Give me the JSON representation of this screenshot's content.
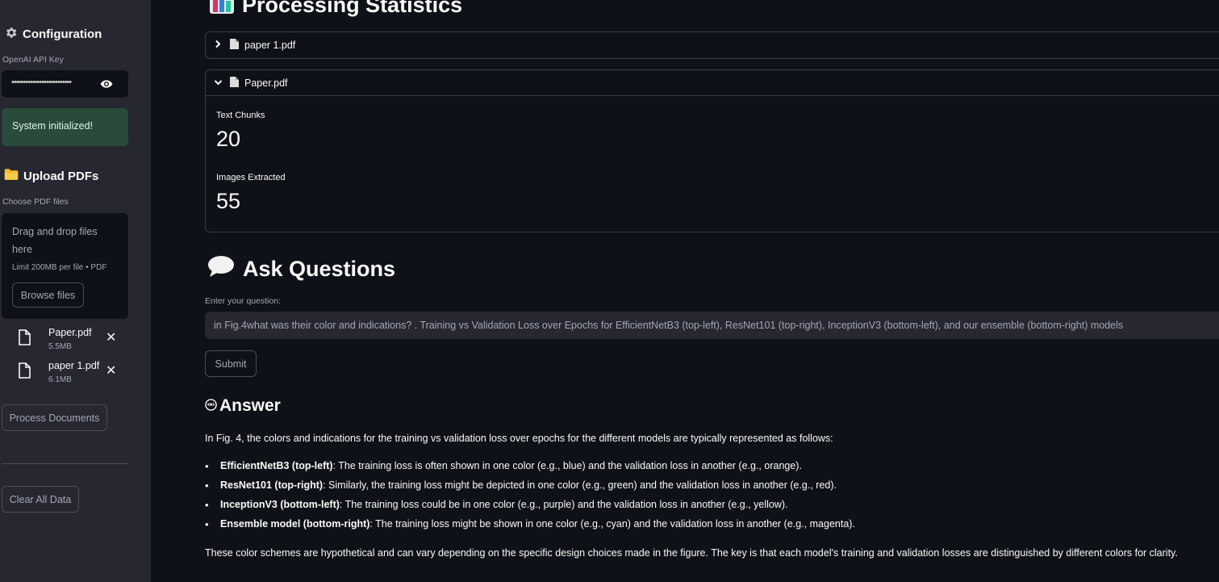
{
  "sidebar": {
    "config_title": "Configuration",
    "api_key_label": "OpenAI API Key",
    "api_key_masked": "••••••••••••••••••••••••••",
    "status_message": "System initialized!",
    "upload_title": "Upload PDFs",
    "choose_label": "Choose PDF files",
    "dropzone_line1": "Drag and drop files",
    "dropzone_line2": "here",
    "dropzone_limit": "Limit 200MB per file • PDF",
    "browse_label": "Browse files",
    "files": [
      {
        "name": "Paper.pdf",
        "size": "5.5MB"
      },
      {
        "name": "paper 1.pdf",
        "size": "6.1MB"
      }
    ],
    "process_label": "Process Documents",
    "clear_label": "Clear All Data"
  },
  "main": {
    "stats_title": "Processing Statistics",
    "expanders": [
      {
        "label": "paper 1.pdf",
        "expanded": false
      },
      {
        "label": "Paper.pdf",
        "expanded": true
      }
    ],
    "metrics": [
      {
        "label": "Text Chunks",
        "value": "20"
      },
      {
        "label": "Images Extracted",
        "value": "55"
      }
    ],
    "ask_title": "Ask Questions",
    "question_label": "Enter your question:",
    "question_value": "in Fig.4what was their color and indications? . Training vs Validation Loss over Epochs for EfficientNetB3 (top-left),  ResNet101 (top-right), InceptionV3 (bottom-left), and our ensemble (bottom-right)  models",
    "submit_label": "Submit",
    "answer_title": "Answer",
    "answer_intro": "In Fig. 4, the colors and indications for the training vs validation loss over epochs for the different models are typically represented as follows:",
    "answer_bullets": [
      {
        "bold": "EfficientNetB3 (top-left)",
        "text": ": The training loss is often shown in one color (e.g., blue) and the validation loss in another (e.g., orange)."
      },
      {
        "bold": "ResNet101 (top-right)",
        "text": ": Similarly, the training loss might be depicted in one color (e.g., green) and the validation loss in another (e.g., red)."
      },
      {
        "bold": "InceptionV3 (bottom-left)",
        "text": ": The training loss could be in one color (e.g., purple) and the validation loss in another (e.g., yellow)."
      },
      {
        "bold": "Ensemble model (bottom-right)",
        "text": ": The training loss might be shown in one color (e.g., cyan) and the validation loss in another (e.g., magenta)."
      }
    ],
    "answer_outro": "These color schemes are hypothetical and can vary depending on the specific design choices made in the figure. The key is that each model's training and validation losses are distinguished by different colors for clarity."
  }
}
